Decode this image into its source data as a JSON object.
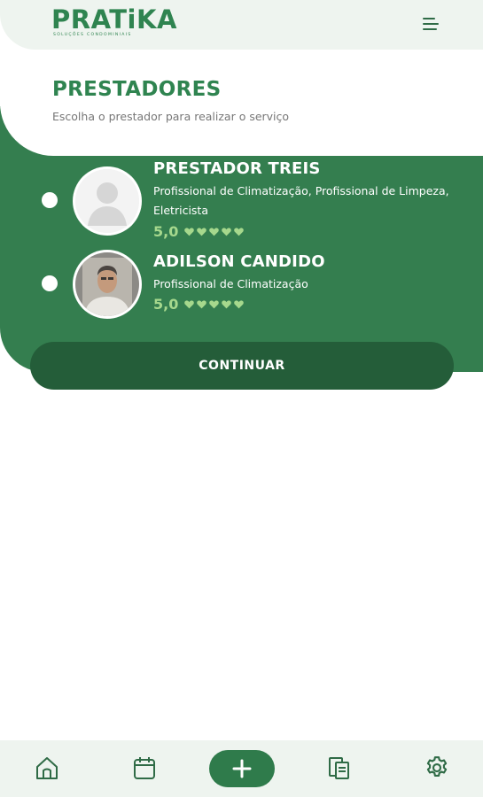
{
  "app": {
    "logo_text": "PRATiKA",
    "logo_tagline": "SOLUÇÕES CONDOMINIAIS",
    "menu_icon": "hamburger-menu-icon"
  },
  "page": {
    "title": "PRESTADORES",
    "subtitle": "Escolha o prestador para realizar o serviço"
  },
  "providers": [
    {
      "name": "PRESTADOR TREIS",
      "services": "Profissional de Climatização, Profissional de Limpeza, Eletricista",
      "rating": "5,0",
      "stars": 5,
      "avatar": "default-user-placeholder",
      "selected": false
    },
    {
      "name": "ADILSON CANDIDO",
      "services": "Profissional de Climatização",
      "rating": "5,0",
      "stars": 5,
      "avatar": "user-photo",
      "selected": false
    }
  ],
  "actions": {
    "continue_label": "CONTINUAR"
  },
  "bottom_nav": [
    {
      "icon": "home-icon"
    },
    {
      "icon": "calendar-icon"
    },
    {
      "icon": "plus-icon"
    },
    {
      "icon": "documents-icon"
    },
    {
      "icon": "gear-icon"
    }
  ],
  "colors": {
    "brand_green": "#2f8450",
    "panel_green": "#347e4f",
    "button_dark_green": "#245d39",
    "rating_green": "#a6d88d",
    "nav_background": "#eef4ef"
  }
}
